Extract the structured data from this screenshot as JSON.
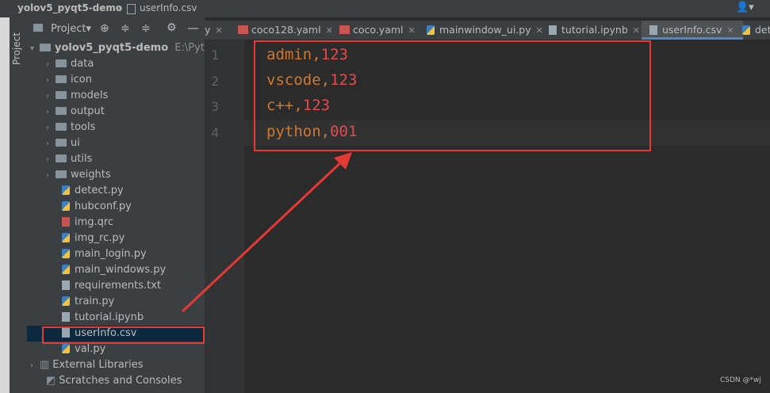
{
  "breadcrumb": {
    "project": "yolov5_pyqt5-demo",
    "file": "userInfo.csv"
  },
  "sidebar_tab": "Project",
  "project_toolbar": {
    "label": "Project"
  },
  "tree": {
    "root": {
      "name": "yolov5_pyqt5-demo",
      "path": "E:\\Python"
    },
    "folders": [
      "data",
      "icon",
      "models",
      "output",
      "tools",
      "ui",
      "utils",
      "weights"
    ],
    "files": [
      "detect.py",
      "hubconf.py",
      "img.qrc",
      "img_rc.py",
      "main_login.py",
      "main_windows.py",
      "requirements.txt",
      "train.py",
      "tutorial.ipynb",
      "userInfo.csv",
      "val.py"
    ],
    "external": "External Libraries",
    "scratches": "Scratches and Consoles"
  },
  "tabs": [
    {
      "label": "y",
      "partial": true
    },
    {
      "label": "coco128.yaml"
    },
    {
      "label": "coco.yaml"
    },
    {
      "label": "mainwindow_ui.py"
    },
    {
      "label": "tutorial.ipynb"
    },
    {
      "label": "userInfo.csv",
      "active": true
    },
    {
      "label": "det",
      "partial": true
    }
  ],
  "editor": {
    "lines": [
      {
        "no": "1",
        "name": "admin",
        "value": "123"
      },
      {
        "no": "2",
        "name": "vscode",
        "value": "123"
      },
      {
        "no": "3",
        "name": "c++",
        "value": "123"
      },
      {
        "no": "4",
        "name": "python",
        "value": "001"
      }
    ]
  },
  "watermark": "CSDN @*wj",
  "colors": {
    "highlight": "#e53935",
    "keyword": "#cc7832",
    "number": "#e34a4a",
    "selection": "#0d293e"
  }
}
